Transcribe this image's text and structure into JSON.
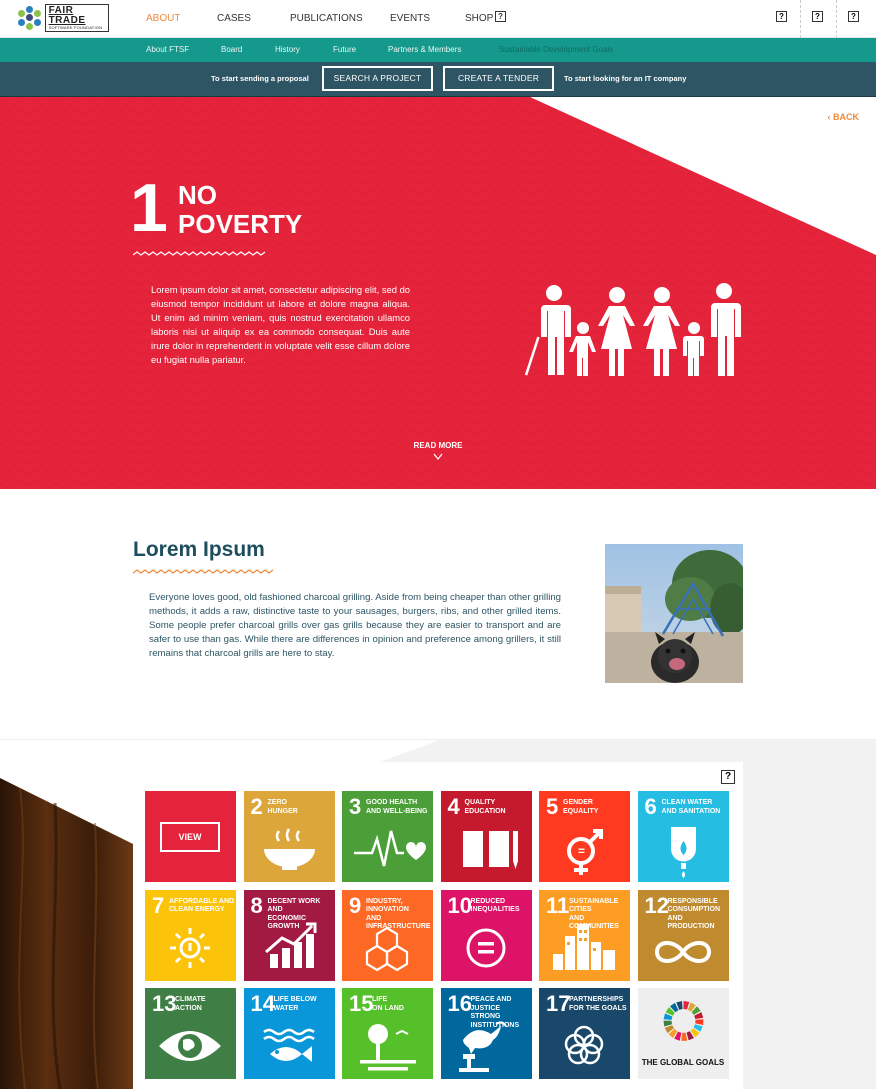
{
  "brand": {
    "name": "FAIR TRADE",
    "tagline": "SOFTWARE FOUNDATION"
  },
  "main_nav": [
    {
      "label": "ABOUT",
      "active": true
    },
    {
      "label": "CASES"
    },
    {
      "label": "PUBLICATIONS"
    },
    {
      "label": "EVENTS"
    },
    {
      "label": "SHOP"
    }
  ],
  "help_glyph": "?",
  "sub_nav": [
    "About FTSF",
    "Board",
    "History",
    "Future",
    "Partners & Members",
    "Sustainable Development Goals"
  ],
  "cta": {
    "left_text": "To start sending a proposal",
    "search_button": "SEARCH A PROJECT",
    "tender_button": "CREATE A TENDER",
    "right_text": "To start looking for an IT company"
  },
  "hero": {
    "back_label": "BACK",
    "goal_number": "1",
    "goal_title_line1": "NO",
    "goal_title_line2": "POVERTY",
    "paragraph": "Lorem ipsum dolor sit amet, consectetur adipiscing elit, sed do eiusmod tempor incididunt ut labore et dolore magna aliqua. Ut enim ad minim veniam, quis nostrud exercitation ullamco laboris nisi ut aliquip ex ea commodo consequat. Duis aute irure dolor in reprehenderit in voluptate velit esse cillum dolore eu fugiat nulla pariatur.",
    "read_more": "READ MORE"
  },
  "article": {
    "title": "Lorem Ipsum",
    "paragraph": "Everyone loves good, old fashioned charcoal grilling. Aside from being cheaper than other grilling methods, it adds a raw, distinctive taste to your sausages, burgers, ribs, and other grilled items. Some people prefer charcoal grills over gas grills because they are easier to transport and are safer to use than gas. While there are differences in opinion and preference among grillers, it still remains that charcoal grills are here to stay."
  },
  "goals": {
    "view_label": "VIEW",
    "global_goals_label": "THE GLOBAL GOALS",
    "tiles": [
      {
        "num": "2",
        "l1": "ZERO",
        "l2": "HUNGER",
        "color": "#dda63a"
      },
      {
        "num": "3",
        "l1": "GOOD HEALTH",
        "l2": "AND WELL-BEING",
        "color": "#4c9f38"
      },
      {
        "num": "4",
        "l1": "QUALITY",
        "l2": "EDUCATION",
        "color": "#c5192d"
      },
      {
        "num": "5",
        "l1": "GENDER",
        "l2": "EQUALITY",
        "color": "#ff3a21"
      },
      {
        "num": "6",
        "l1": "CLEAN WATER",
        "l2": "AND SANITATION",
        "color": "#26bde2"
      },
      {
        "num": "7",
        "l1": "AFFORDABLE AND",
        "l2": "CLEAN ENERGY",
        "color": "#fcc30b"
      },
      {
        "num": "8",
        "l1": "DECENT WORK AND",
        "l2": "ECONOMIC GROWTH",
        "color": "#a21942"
      },
      {
        "num": "9",
        "l1": "INDUSTRY, INNOVATION",
        "l2": "AND INFRASTRUCTURE",
        "color": "#fd6925"
      },
      {
        "num": "10",
        "l1": "REDUCED",
        "l2": "INEQUALITIES",
        "color": "#dd1367"
      },
      {
        "num": "11",
        "l1": "SUSTAINABLE CITIES",
        "l2": "AND COMMUNITIES",
        "color": "#fd9d24"
      },
      {
        "num": "12",
        "l1": "RESPONSIBLE",
        "l2": "CONSUMPTION",
        "l3": "AND PRODUCTION",
        "color": "#bf8b2e"
      },
      {
        "num": "13",
        "l1": "CLIMATE",
        "l2": "ACTION",
        "color": "#3f7e44"
      },
      {
        "num": "14",
        "l1": "LIFE BELOW",
        "l2": "WATER",
        "color": "#0a97d9"
      },
      {
        "num": "15",
        "l1": "LIFE",
        "l2": "ON LAND",
        "color": "#56c02b"
      },
      {
        "num": "16",
        "l1": "PEACE AND JUSTICE",
        "l2": "STRONG INSTITUTIONS",
        "color": "#00689d"
      },
      {
        "num": "17",
        "l1": "PARTNERSHIPS",
        "l2": "FOR THE GOALS",
        "color": "#19486a"
      }
    ]
  },
  "colors": {
    "goal1": "#e5243b",
    "teal": "#15998c",
    "navy": "#2d5564",
    "accent": "#f08a3c"
  }
}
